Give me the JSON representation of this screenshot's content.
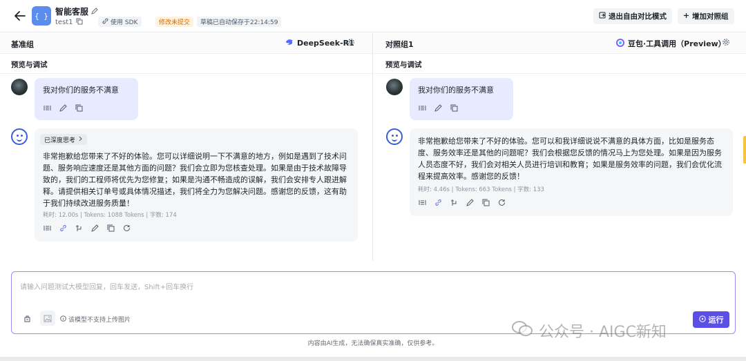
{
  "header": {
    "app_name": "智能客服",
    "app_id": "test1",
    "sdk_label": "使用 SDK",
    "status_label": "修改未提交",
    "save_label": "草稿已自动保存于22:14:59",
    "exit_compare_label": "退出自由对比模式",
    "add_group_label": "增加对照组",
    "logo_text": "{ }"
  },
  "left_panel": {
    "title": "基准组",
    "model": "DeepSeek-R1",
    "section_title": "预览与调试",
    "user_message": "我对你们的服务不满意",
    "think_label": "已深度思考",
    "bot_message": "非常抱歉给您带来了不好的体验。您可以详细说明一下不满意的地方，例如是遇到了技术问题、服务响应速度还是其他方面的问题？我们会立即为您核查处理。如果是由于技术故障导致的，我们的工程师将优先为您修复；如果是沟通不畅造成的误解，我们会安排专人跟进解释。请提供相关订单号或具体情况描述，我们将全力为您解决问题。感谢您的反馈，这有助于我们持续改进服务质量！",
    "meta": "耗时: 12.00s | Tokens: 1088 Tokens | 字数: 174"
  },
  "right_panel": {
    "title": "对照组1",
    "model": "豆包·工具调用（Preview）",
    "section_title": "预览与调试",
    "user_message": "我对你们的服务不满意",
    "bot_message": "非常抱歉给您带来了不好的体验。您可以和我详细说说不满意的具体方面，比如是服务态度、服务效率还是其他的问题呢？我们会根据您反馈的情况马上为您处理。如果是因为服务人员态度不好，我们会对相关人员进行培训和教育；如果是服务效率的问题，我们会优化流程来提高效率。感谢您的反馈！",
    "meta": "耗时: 4.46s | Tokens: 663 Tokens | 字数: 133"
  },
  "input": {
    "placeholder": "请输入问题测试大模型回复，回车发送，Shift+回车换行",
    "no_image_note": "该模型不支持上传图片",
    "run_label": "运行"
  },
  "footer": {
    "disclaimer": "内容由AI生成，无法确保真实准确，仅供参考。",
    "watermark": "公众号 · AIGC新知"
  },
  "colors": {
    "accent": "#5b4fe8",
    "user_bubble": "#e8ebff",
    "bot_bubble": "#f5f6f8",
    "status_orange": "#d26a00"
  }
}
